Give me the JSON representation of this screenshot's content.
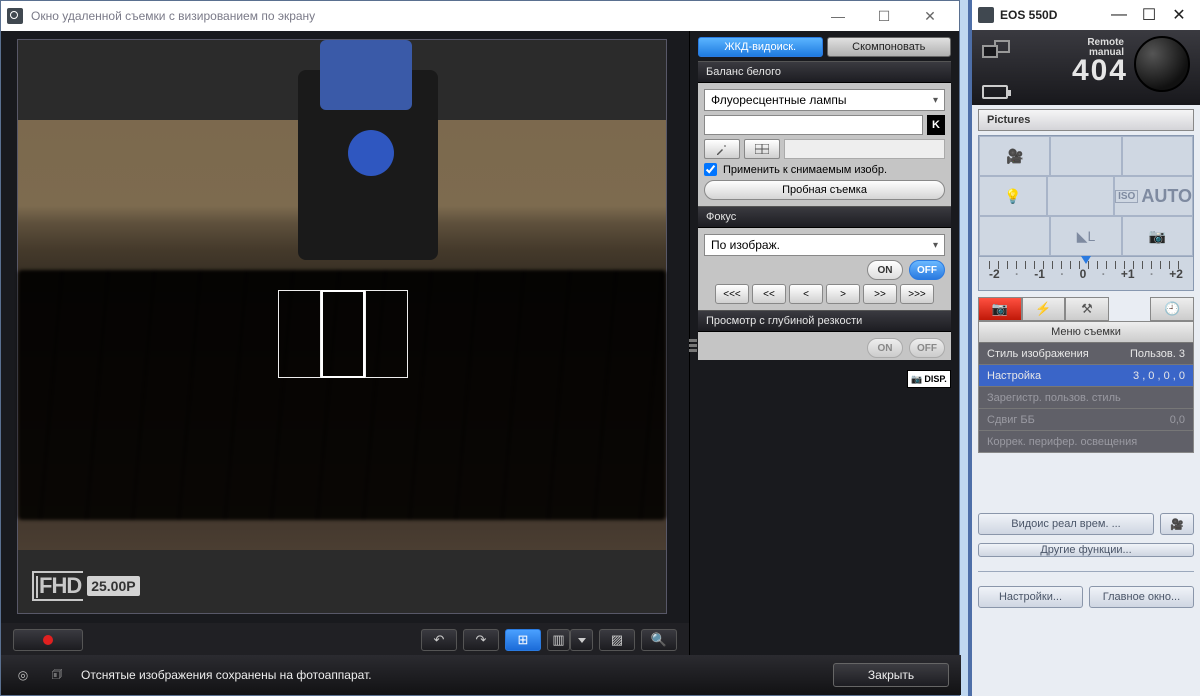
{
  "main": {
    "title": "Окно удаленной съемки с визированием по экрану",
    "tabs": {
      "lcd": "ЖКД-видоиск.",
      "compose": "Скомпоновать"
    },
    "wb": {
      "header": "Баланс белого",
      "preset": "Флуоресцентные лампы",
      "kelvin_label": "K",
      "applyTo": "Применить к снимаемым изобр.",
      "testShot": "Пробная съемка"
    },
    "focus": {
      "header": "Фокус",
      "mode": "По изображ.",
      "on": "ON",
      "off": "OFF",
      "steps": [
        "<<<",
        "<<",
        "<",
        ">",
        ">>",
        ">>>"
      ]
    },
    "dof": {
      "header": "Просмотр с глубиной резкости",
      "on": "ON",
      "off": "OFF"
    },
    "disp": "DISP.",
    "fhd": "FHD",
    "fps": "25.00P",
    "status": "Отснятые изображения сохранены на фотоаппарат.",
    "close": "Закрыть"
  },
  "cc": {
    "title": "EOS 550D",
    "modeLabel1": "Remote",
    "modeLabel2": "manual",
    "counter": "404",
    "folder": "Pictures",
    "auto": "AUTO",
    "qual": "◣L",
    "scale": [
      "-2",
      "-1",
      "0",
      "+1",
      "+2"
    ],
    "menuHeader": "Меню съемки",
    "rows": [
      {
        "k": "Стиль изображения",
        "v": "Пользов. 3",
        "sel": false
      },
      {
        "k": "Настройка",
        "v": "3 , 0 , 0 , 0",
        "sel": true
      },
      {
        "k": "Зарегистр. пользов. стиль",
        "v": "",
        "dis": true
      },
      {
        "k": "Сдвиг ББ",
        "v": "0,0",
        "dis": true
      },
      {
        "k": "Коррек. перифер. освещения",
        "v": "",
        "dis": true
      }
    ],
    "liveview": "Видоис реал врем. ...",
    "other": "Другие функции...",
    "settings": "Настройки...",
    "mainwin": "Главное окно..."
  }
}
